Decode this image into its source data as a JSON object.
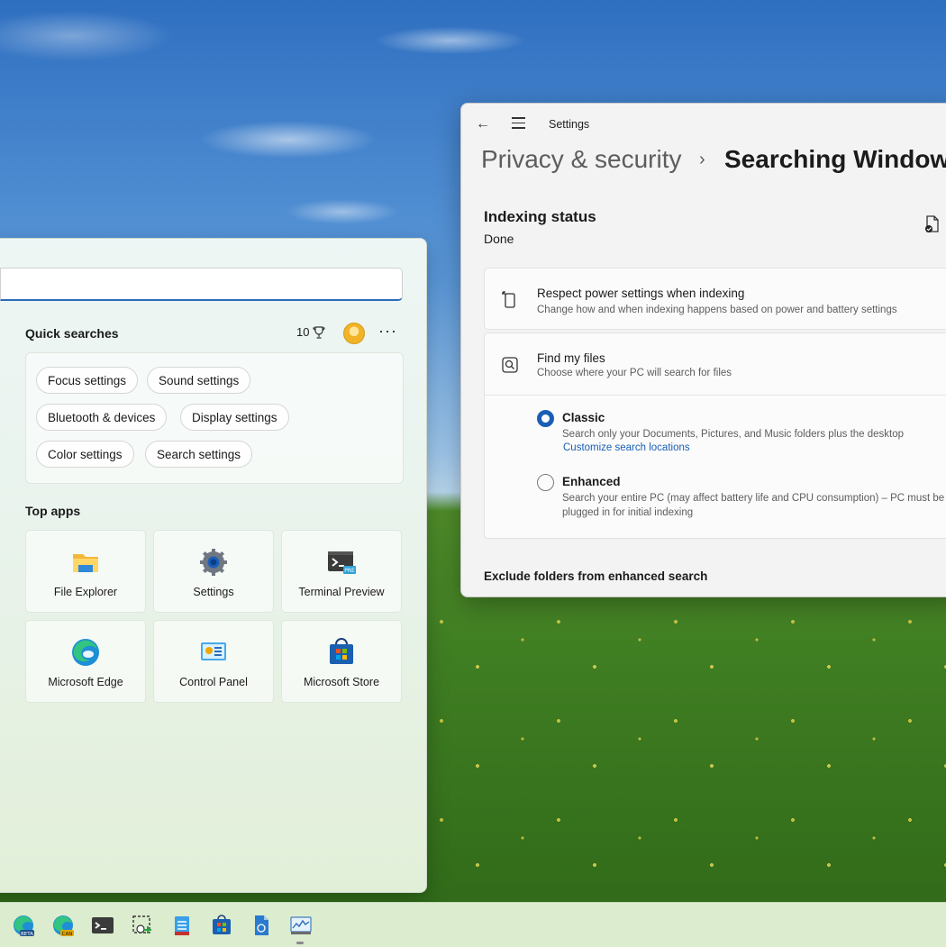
{
  "search": {
    "quick_searches_title": "Quick searches",
    "points": "10",
    "chips": [
      "Focus settings",
      "Sound settings",
      "Bluetooth & devices",
      "Display settings",
      "Color settings",
      "Search settings"
    ],
    "top_apps_title": "Top apps",
    "apps": [
      {
        "label": "File Explorer",
        "icon": "folder-icon"
      },
      {
        "label": "Settings",
        "icon": "gear-icon"
      },
      {
        "label": "Terminal Preview",
        "icon": "terminal-icon"
      },
      {
        "label": "Microsoft Edge",
        "icon": "edge-icon"
      },
      {
        "label": "Control Panel",
        "icon": "control-panel-icon"
      },
      {
        "label": "Microsoft Store",
        "icon": "store-icon"
      }
    ]
  },
  "settings": {
    "window_title": "Settings",
    "breadcrumb_parent": "Privacy & security",
    "breadcrumb_separator": "›",
    "breadcrumb_current": "Searching Windows",
    "indexing_title": "Indexing status",
    "indexing_status": "Done",
    "power": {
      "title": "Respect power settings when indexing",
      "subtitle": "Change how and when indexing happens based on power and battery settings"
    },
    "find_files": {
      "title": "Find my files",
      "subtitle": "Choose where your PC will search for files",
      "classic": {
        "title": "Classic",
        "desc": "Search only your Documents, Pictures, and Music folders plus the desktop",
        "link": "Customize search locations",
        "selected": true
      },
      "enhanced": {
        "title": "Enhanced",
        "desc": "Search your entire PC (may affect battery life and CPU consumption) – PC must be plugged in for initial indexing",
        "selected": false
      }
    },
    "exclude_title": "Exclude folders from enhanced search"
  },
  "taskbar": {
    "icons": [
      "edge-beta-icon",
      "edge-canary-icon",
      "terminal-icon",
      "snipping-tool-icon",
      "notepad-icon",
      "store-icon",
      "file-icon",
      "performance-monitor-icon"
    ]
  },
  "colors": {
    "accent": "#1a5fb4",
    "search_panel_bg": "#e9f3ec",
    "settings_bg": "#f3f3f3",
    "taskbar_bg": "#dcecce"
  }
}
